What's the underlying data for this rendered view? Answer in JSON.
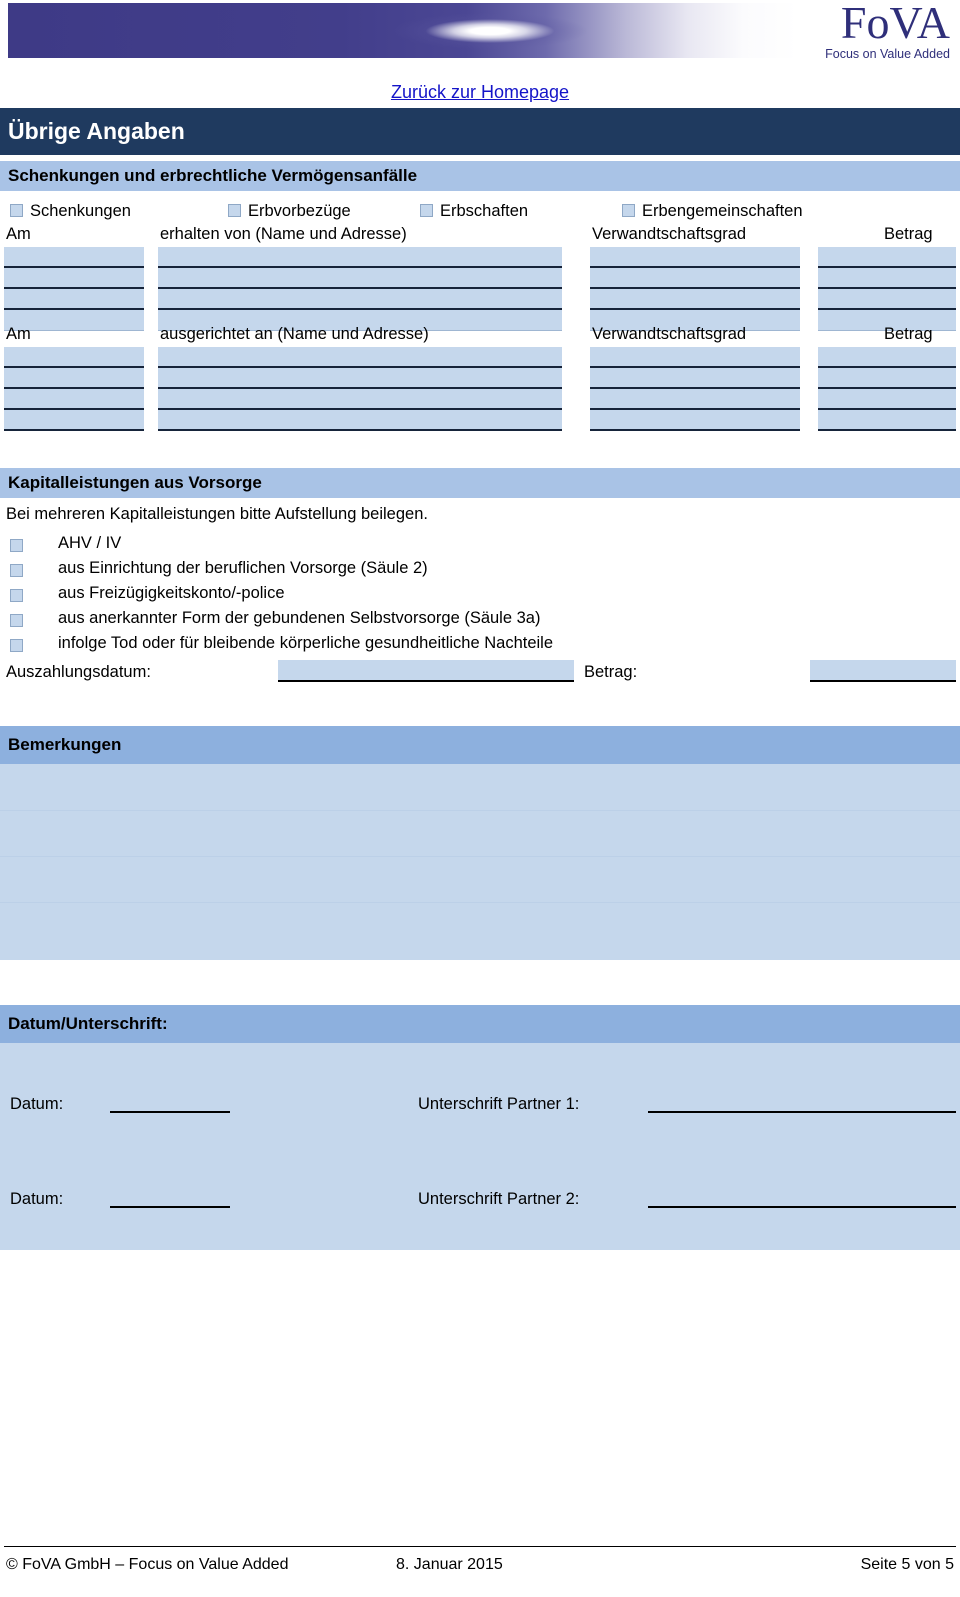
{
  "brand": {
    "logo_text": "FoVA",
    "logo_o": "o",
    "tagline": "Focus on Value Added"
  },
  "nav": {
    "back_link": "Zurück zur Homepage"
  },
  "title_bar": {
    "title": "Übrige Angaben"
  },
  "sections": {
    "gifts": {
      "heading": "Schenkungen und erbrechtliche Vermögensanfälle",
      "checkboxes": [
        {
          "label": "Schenkungen"
        },
        {
          "label": "Erbvorbezüge"
        },
        {
          "label": "Erbschaften"
        },
        {
          "label": "Erbengemeinschaften"
        }
      ],
      "received_table": {
        "columns": [
          "Am",
          "erhalten von (Name und Adresse)",
          "Verwandtschaftsgrad",
          "Betrag"
        ],
        "rows": [
          [
            "",
            "",
            "",
            ""
          ],
          [
            "",
            "",
            "",
            ""
          ],
          [
            "",
            "",
            "",
            ""
          ],
          [
            "",
            "",
            "",
            ""
          ]
        ]
      },
      "given_table": {
        "columns": [
          "Am",
          "ausgerichtet an (Name und Adresse)",
          "Verwandtschaftsgrad",
          "Betrag"
        ],
        "rows": [
          [
            "",
            "",
            "",
            ""
          ],
          [
            "",
            "",
            "",
            ""
          ],
          [
            "",
            "",
            "",
            ""
          ],
          [
            "",
            "",
            "",
            ""
          ]
        ]
      }
    },
    "pension": {
      "heading": "Kapitalleistungen aus Vorsorge",
      "note": "Bei mehreren Kapitalleistungen bitte Aufstellung beilegen.",
      "options": [
        {
          "label": "AHV / IV"
        },
        {
          "label": "aus Einrichtung der beruflichen Vorsorge (Säule 2)"
        },
        {
          "label": "aus Freizügigkeitskonto/-police"
        },
        {
          "label": "aus anerkannter Form der gebundenen Selbstvorsorge (Säule 3a)"
        },
        {
          "label": "infolge Tod oder für bleibende körperliche gesundheitliche Nachteile"
        }
      ],
      "payout_date_label": "Auszahlungsdatum:",
      "payout_date_value": "",
      "amount_label": "Betrag:",
      "amount_value": ""
    },
    "remarks": {
      "heading": "Bemerkungen",
      "value": ""
    },
    "signature": {
      "heading": "Datum/Unterschrift:",
      "rows": [
        {
          "date_label": "Datum:",
          "date_value": "",
          "signature_label": "Unterschrift Partner 1:",
          "signature_value": ""
        },
        {
          "date_label": "Datum:",
          "date_value": "",
          "signature_label": "Unterschrift Partner 2:",
          "signature_value": ""
        }
      ]
    }
  },
  "footer": {
    "copyright": "© FoVA GmbH – Focus on Value Added",
    "date": "8. Januar 2015",
    "page": "Seite 5 von 5"
  },
  "colors": {
    "title_bar": "#1f3a5f",
    "section_bar": "#a9c3e6",
    "section_bar_dark": "#8db0de",
    "field_fill": "#c5d7ec",
    "link": "#1414c8",
    "brand": "#2f2f7a"
  }
}
